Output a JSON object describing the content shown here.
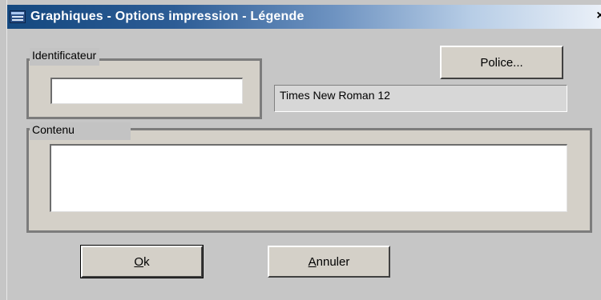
{
  "window": {
    "title": "Graphiques - Options impression -  Légende",
    "close_glyph": "×"
  },
  "identificateur": {
    "label": "Identificateur",
    "value": ""
  },
  "police": {
    "button_label": "Police...",
    "current_font": "Times New Roman 12"
  },
  "contenu": {
    "label": "Contenu",
    "value": ""
  },
  "buttons": {
    "ok_mnemonic": "O",
    "ok_rest": "k",
    "cancel_mnemonic": "A",
    "cancel_rest": "nnuler"
  }
}
